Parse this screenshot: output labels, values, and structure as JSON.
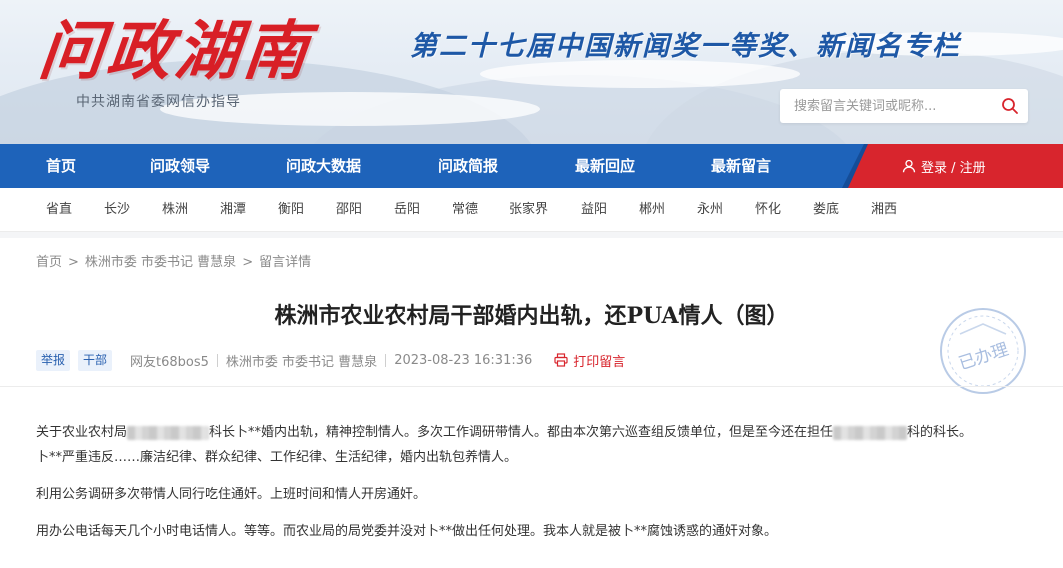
{
  "header": {
    "logo_text": "问政湖南",
    "logo_subtitle": "中共湖南省委网信办指导",
    "slogan": "第二十七届中国新闻奖一等奖、新闻名专栏",
    "search": {
      "placeholder": "搜索留言关键词或昵称...",
      "icon": "search-icon"
    }
  },
  "nav": {
    "items": [
      "首页",
      "问政领导",
      "问政大数据",
      "问政简报",
      "最新回应",
      "最新留言"
    ],
    "login_label": "登录 / 注册",
    "login_icon": "user-icon"
  },
  "cities": [
    "省直",
    "长沙",
    "株洲",
    "湘潭",
    "衡阳",
    "邵阳",
    "岳阳",
    "常德",
    "张家界",
    "益阳",
    "郴州",
    "永州",
    "怀化",
    "娄底",
    "湘西"
  ],
  "breadcrumb": [
    "首页",
    "株洲市委 市委书记 曹慧泉",
    "留言详情"
  ],
  "article": {
    "title": "株洲市农业农村局干部婚内出轨，还PUA情人（图）",
    "tags": [
      "举报",
      "干部"
    ],
    "author": "网友t68bos5",
    "target": "株洲市委 市委书记 曹慧泉",
    "datetime": "2023-08-23 16:31:36",
    "print_label": "打印留言",
    "stamp_text": "已办理",
    "para1": {
      "a": "关于农业农村局",
      "b": "科长卜**婚内出轨，精神控制情人。多次工作调研带情人。都由本次第六巡查组反馈单位，但是至今还在担任",
      "c": "科的科长。",
      "d": "卜**严重违反……廉洁纪律、群众纪律、工作纪律、生活纪律，婚内出轨包养情人。"
    },
    "para2": "利用公务调研多次带情人同行吃住通奸。上班时间和情人开房通奸。",
    "para3": "用办公电话每天几个小时电话情人。等等。而农业局的局党委并没对卜**做出任何处理。我本人就是被卜**腐蚀诱惑的通奸对象。"
  },
  "colors": {
    "nav_blue": "#1e63ba",
    "login_red": "#d8252d",
    "logo_red": "#d81f26",
    "slogan_blue": "#1e58a6"
  }
}
